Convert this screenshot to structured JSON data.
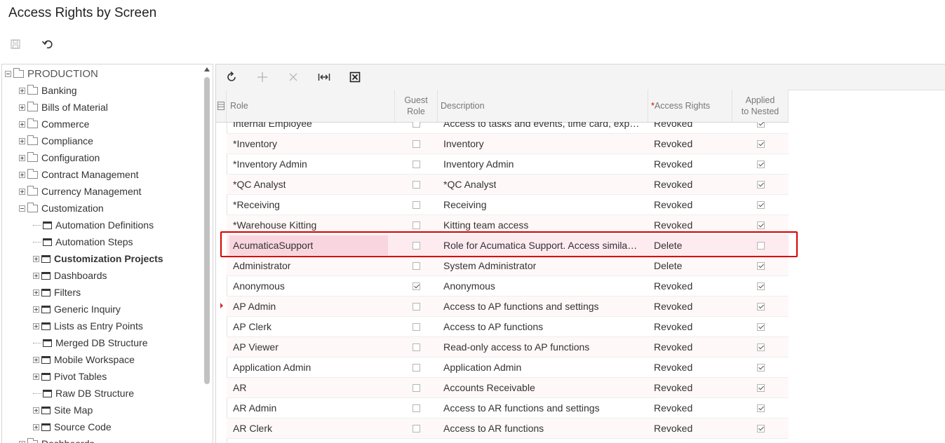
{
  "page": {
    "title": "Access Rights by Screen"
  },
  "toolbar": {
    "save_icon": "save-icon",
    "undo_icon": "undo-icon"
  },
  "tree": {
    "root": "PRODUCTION",
    "items": [
      {
        "label": "Banking"
      },
      {
        "label": "Bills of Material"
      },
      {
        "label": "Commerce"
      },
      {
        "label": "Compliance"
      },
      {
        "label": "Configuration"
      },
      {
        "label": "Contract Management"
      },
      {
        "label": "Currency Management"
      },
      {
        "label": "Customization"
      },
      {
        "label": "Automation Definitions"
      },
      {
        "label": "Automation Steps"
      },
      {
        "label": "Customization Projects"
      },
      {
        "label": "Dashboards"
      },
      {
        "label": "Filters"
      },
      {
        "label": "Generic Inquiry"
      },
      {
        "label": "Lists as Entry Points"
      },
      {
        "label": "Merged DB Structure"
      },
      {
        "label": "Mobile Workspace"
      },
      {
        "label": "Pivot Tables"
      },
      {
        "label": "Raw DB Structure"
      },
      {
        "label": "Site Map"
      },
      {
        "label": "Source Code"
      },
      {
        "label": "Dashboards"
      }
    ]
  },
  "grid": {
    "toolbar": [
      "refresh-icon",
      "add-icon",
      "delete-icon",
      "fit-columns-icon",
      "export-excel-icon"
    ],
    "columns": {
      "role": "Role",
      "guest_role_1": "Guest",
      "guest_role_2": "Role",
      "description": "Description",
      "access_rights_req": "*",
      "access_rights": "Access Rights",
      "applied_1": "Applied",
      "applied_2": "to Nested"
    },
    "rows": [
      {
        "role": "Internal Employee",
        "guest": false,
        "description": "Access to tasks and events, time card, expense...",
        "access": "Revoked",
        "applied": true
      },
      {
        "role": "*Inventory",
        "guest": false,
        "description": "Inventory",
        "access": "Revoked",
        "applied": true
      },
      {
        "role": "*Inventory Admin",
        "guest": false,
        "description": "Inventory Admin",
        "access": "Revoked",
        "applied": true
      },
      {
        "role": "*QC Analyst",
        "guest": false,
        "description": "*QC Analyst",
        "access": "Revoked",
        "applied": true
      },
      {
        "role": "*Receiving",
        "guest": false,
        "description": "Receiving",
        "access": "Revoked",
        "applied": true
      },
      {
        "role": "*Warehouse Kitting",
        "guest": false,
        "description": "Kitting team access",
        "access": "Revoked",
        "applied": true
      },
      {
        "role": "AcumaticaSupport",
        "guest": false,
        "description": "Role for Acumatica Support. Access similar to ...",
        "access": "Delete",
        "applied": false
      },
      {
        "role": "Administrator",
        "guest": false,
        "description": "System Administrator",
        "access": "Delete",
        "applied": true
      },
      {
        "role": "Anonymous",
        "guest": true,
        "description": "Anonymous",
        "access": "Revoked",
        "applied": true
      },
      {
        "role": "AP Admin",
        "guest": false,
        "description": "Access to AP functions and settings",
        "access": "Revoked",
        "applied": true
      },
      {
        "role": "AP Clerk",
        "guest": false,
        "description": "Access to AP functions",
        "access": "Revoked",
        "applied": true
      },
      {
        "role": "AP Viewer",
        "guest": false,
        "description": "Read-only access to AP functions",
        "access": "Revoked",
        "applied": true
      },
      {
        "role": "Application Admin",
        "guest": false,
        "description": "Application Admin",
        "access": "Revoked",
        "applied": true
      },
      {
        "role": "AR",
        "guest": false,
        "description": "Accounts Receivable",
        "access": "Revoked",
        "applied": true
      },
      {
        "role": "AR Admin",
        "guest": false,
        "description": "Access to AR functions and settings",
        "access": "Revoked",
        "applied": true
      },
      {
        "role": "AR Clerk",
        "guest": false,
        "description": "Access to AR functions",
        "access": "Revoked",
        "applied": true
      }
    ]
  }
}
